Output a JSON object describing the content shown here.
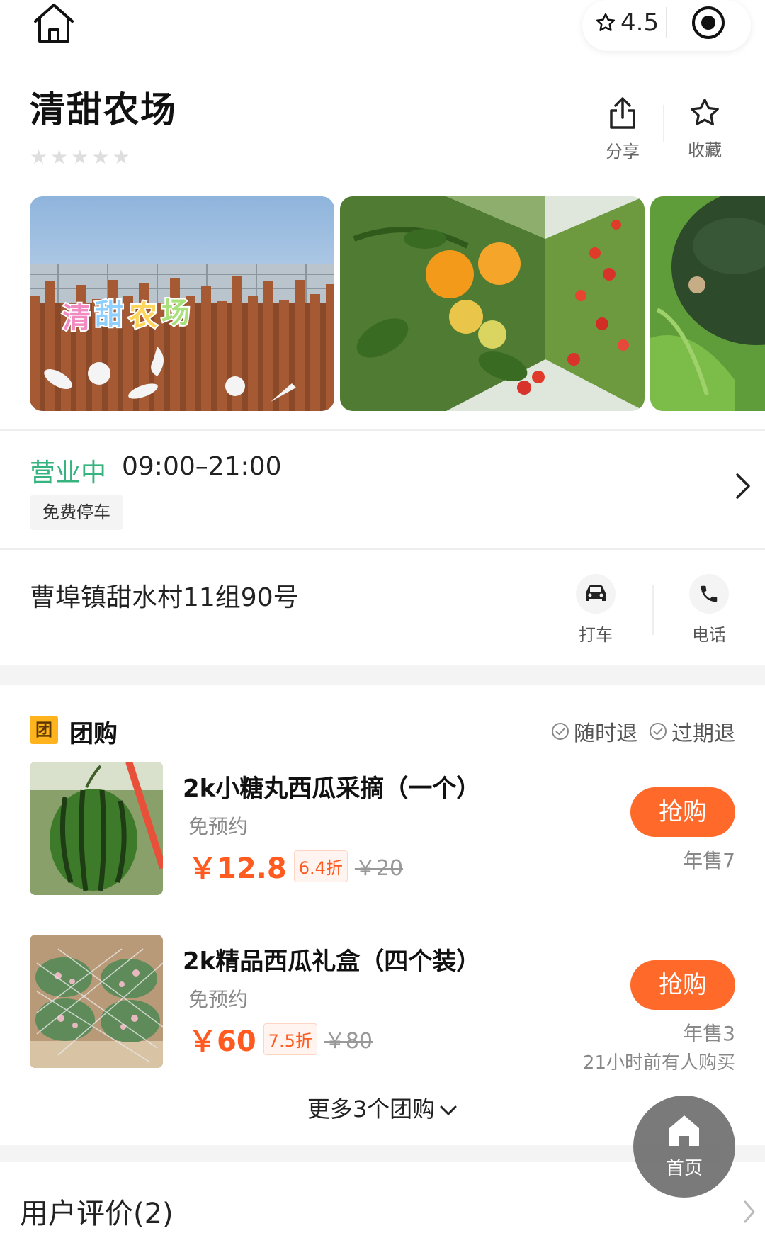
{
  "topbar": {
    "rating": "4.5"
  },
  "shop": {
    "title": "清甜农场",
    "stars_filled": 0,
    "stars_total": 5
  },
  "actions": {
    "share_label": "分享",
    "favorite_label": "收藏"
  },
  "photos": [
    {
      "sign_text": "清甜农场"
    }
  ],
  "hours": {
    "status": "营业中",
    "time": "09:00–21:00",
    "tag": "免费停车"
  },
  "address": {
    "text": "曹埠镇甜水村11组90号",
    "taxi_label": "打车",
    "phone_label": "电话"
  },
  "group_buy": {
    "badge": "团",
    "title": "团购",
    "policies": [
      "随时退",
      "过期退"
    ],
    "deals": [
      {
        "name": "2k小糖丸西瓜采摘（一个）",
        "sub": "免预约",
        "price": "￥12.8",
        "discount": "6.4折",
        "original": "￥20",
        "button": "抢购",
        "sold": "年售7",
        "recent": ""
      },
      {
        "name": "2k精品西瓜礼盒（四个装）",
        "sub": "免预约",
        "price": "￥60",
        "discount": "7.5折",
        "original": "￥80",
        "button": "抢购",
        "sold": "年售3",
        "recent": "21小时前有人购买"
      }
    ],
    "more": "更多3个团购"
  },
  "float_home": {
    "label": "首页"
  },
  "reviews": {
    "title": "用户评价(2)"
  },
  "colors": {
    "accent": "#ff6a2b",
    "price": "#ff5a1f",
    "open_status": "#36b37e",
    "badge": "#ffb41e"
  },
  "icons": [
    "home-icon",
    "star-outline-icon",
    "record-icon",
    "share-icon",
    "star-icon",
    "chevron-right-icon",
    "car-icon",
    "phone-icon",
    "check-circle-icon",
    "chevron-down-icon"
  ]
}
